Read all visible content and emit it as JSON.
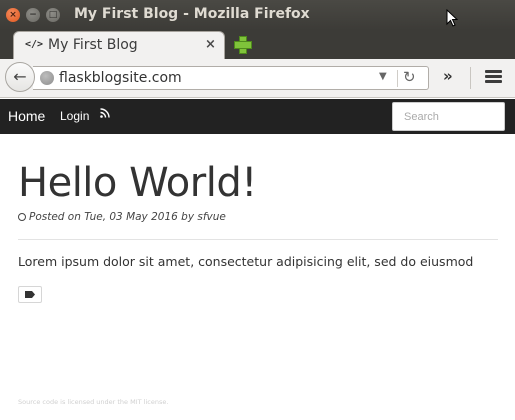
{
  "window": {
    "title": "My First Blog - Mozilla Firefox",
    "close_glyph": "×",
    "minimize_glyph": "−",
    "maximize_glyph": "□"
  },
  "tabs": [
    {
      "favicon": "</>",
      "label": "My First Blog",
      "close_glyph": "×"
    }
  ],
  "navbar": {
    "back_glyph": "←",
    "url": "flaskblogsite.com",
    "dropdown_glyph": "▼",
    "reload_glyph": "↻",
    "overflow_glyph": "»"
  },
  "site_nav": {
    "home": "Home",
    "login": "Login",
    "rss_icon": "rss-icon",
    "search_placeholder": "Search"
  },
  "post": {
    "title": "Hello World!",
    "meta": "Posted on Tue, 03 May 2016 by sfvue",
    "body": "Lorem ipsum dolor sit amet, consectetur adipisicing elit, sed do eiusmod",
    "tag_icon": "tags-icon"
  },
  "footer": {
    "text": "Source code is licensed under the MIT license."
  },
  "colors": {
    "titlebar": "#3c3b37",
    "site_nav": "#222222",
    "new_tab_plus": "#7fc33a",
    "close_button": "#e0581f"
  }
}
